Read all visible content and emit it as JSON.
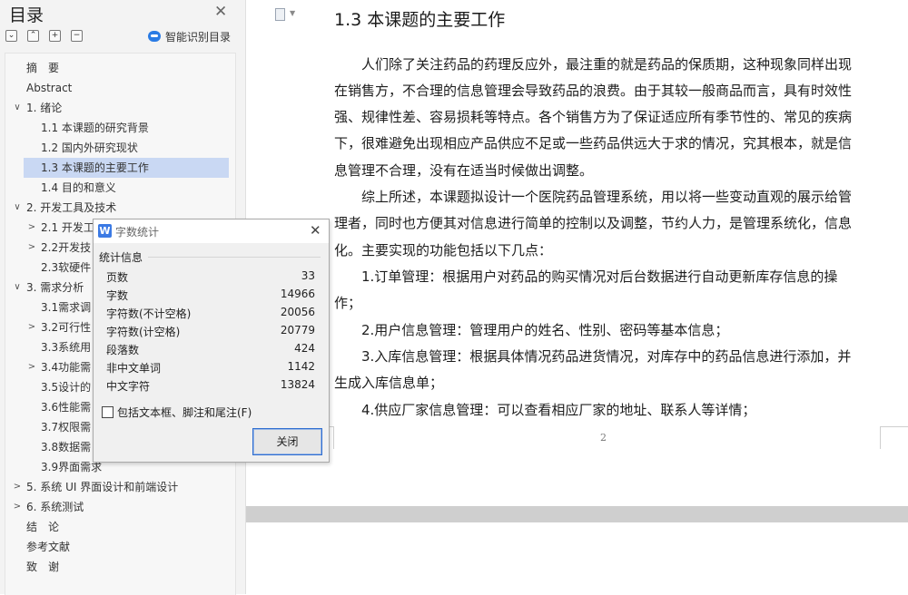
{
  "sidebar": {
    "title": "目录",
    "smart_toc_label": "智能识别目录",
    "toolbar": {
      "collapse_all": "⌄",
      "expand_all": "⌃",
      "add": "+",
      "remove": "−"
    },
    "items": [
      {
        "label": "摘　要",
        "arrow": ""
      },
      {
        "label": "Abstract",
        "arrow": ""
      },
      {
        "label": "1.  绪论",
        "arrow": "∨"
      },
      {
        "label": "1.1  本课题的研究背景",
        "arrow": ""
      },
      {
        "label": "1.2  国内外研究现状",
        "arrow": ""
      },
      {
        "label": "1.3  本课题的主要工作",
        "arrow": "",
        "selected": true
      },
      {
        "label": "1.4  目的和意义",
        "arrow": ""
      },
      {
        "label": "2.  开发工具及技术",
        "arrow": "∨"
      },
      {
        "label": "2.1  开发工",
        "arrow": ">"
      },
      {
        "label": "2.2开发技",
        "arrow": ">"
      },
      {
        "label": "2.3软硬件",
        "arrow": ""
      },
      {
        "label": "3.  需求分析",
        "arrow": "∨"
      },
      {
        "label": "3.1需求调",
        "arrow": ""
      },
      {
        "label": "3.2可行性",
        "arrow": ">"
      },
      {
        "label": "3.3系统用",
        "arrow": ""
      },
      {
        "label": "3.4功能需",
        "arrow": ">"
      },
      {
        "label": "3.5设计的",
        "arrow": ""
      },
      {
        "label": "3.6性能需",
        "arrow": ""
      },
      {
        "label": "3.7权限需",
        "arrow": ""
      },
      {
        "label": "3.8数据需",
        "arrow": ""
      },
      {
        "label": "3.9界面需求",
        "arrow": ""
      },
      {
        "label": "5.  系统 UI 界面设计和前端设计",
        "arrow": ">"
      },
      {
        "label": "6.  系统测试",
        "arrow": ">"
      },
      {
        "label": "结　论",
        "arrow": ""
      },
      {
        "label": "参考文献",
        "arrow": ""
      },
      {
        "label": "致　谢",
        "arrow": ""
      }
    ]
  },
  "document": {
    "heading": "1.3  本课题的主要工作",
    "lines": [
      "　　人们除了关注药品的药理反应外，最注重的就是药品的保质期，这种现象同样出现",
      "在销售方，不合理的信息管理会导致药品的浪费。由于其较一般商品而言，具有时效性",
      "强、规律性差、容易损耗等特点。各个销售方为了保证适应所有季节性的、常见的疾病",
      "下，很难避免出现相应产品供应不足或一些药品供远大于求的情况，究其根本，就是信",
      "息管理不合理，没有在适当时候做出调整。",
      "　　综上所述，本课题拟设计一个医院药品管理系统，用以将一些变动直观的展示给管",
      "理者，同时也方便其对信息进行简单的控制以及调整，节约人力，是管理系统化，信息",
      "化。主要实现的功能包括以下几点：",
      "　　1.订单管理：根据用户对药品的购买情况对后台数据进行自动更新库存信息的操",
      "作；",
      "　　2.用户信息管理：管理用户的姓名、性别、密码等基本信息；",
      "　　3.入库信息管理：根据具体情况药品进货情况，对库存中的药品信息进行添加，并",
      "生成入库信息单；",
      "　　4.供应厂家信息管理：可以查看相应厂家的地址、联系人等详情；"
    ],
    "page_number": "2"
  },
  "dialog": {
    "title": "字数统计",
    "icon_letter": "W",
    "group_label": "统计信息",
    "stats": [
      {
        "label": "页数",
        "value": "33"
      },
      {
        "label": "字数",
        "value": "14966"
      },
      {
        "label": "字符数(不计空格)",
        "value": "20056"
      },
      {
        "label": "字符数(计空格)",
        "value": "20779"
      },
      {
        "label": "段落数",
        "value": "424"
      },
      {
        "label": "非中文单词",
        "value": "1142"
      },
      {
        "label": "中文字符",
        "value": "13824"
      }
    ],
    "checkbox_label": "包括文本框、脚注和尾注(F)",
    "close_button": "关闭"
  },
  "colors": {
    "selection": "#c9d8f3",
    "accent": "#2a7be4",
    "button_border": "#2f6ed0"
  }
}
